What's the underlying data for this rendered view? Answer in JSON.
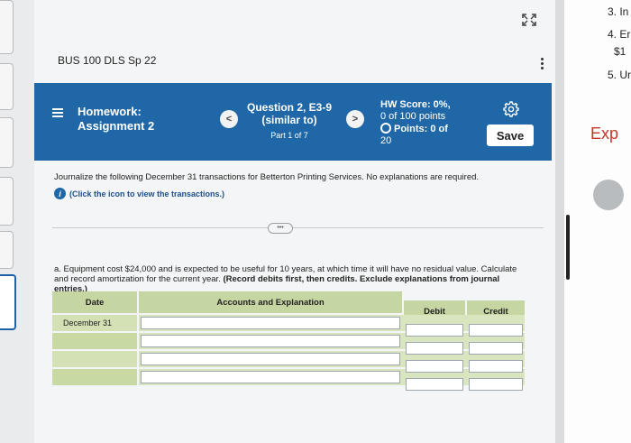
{
  "course": "BUS 100 DLS Sp 22",
  "banner": {
    "homework_line1": "Homework:",
    "homework_line2": "Assignment 2",
    "question_line1": "Question 2, E3-9",
    "question_line2": "(similar to)",
    "part": "Part 1 of 7",
    "score_head": "HW Score: 0%,",
    "score_sub": "0 of 100 points",
    "points_label": "Points: 0 of",
    "points_total": "20",
    "save_label": "Save",
    "prev_symbol": "<",
    "next_symbol": ">"
  },
  "instructions": "Journalize the following December 31 transactions for Betterton Printing Services. No explanations are required.",
  "info_link": "(Click the icon to view the transactions.)",
  "more_pill": "•••",
  "question": {
    "text": "a. Equipment cost $24,000 and is expected to be useful for 10 years, at which time it will have no residual value. Calculate and record amortization for the current year.",
    "emphasis": "(Record debits first, then credits. Exclude explanations from journal entries.)"
  },
  "journal": {
    "headers": {
      "date": "Date",
      "account": "Accounts and Explanation",
      "debit": "Debit",
      "credit": "Credit"
    },
    "rows": [
      {
        "date": "December 31"
      },
      {
        "date": ""
      },
      {
        "date": ""
      },
      {
        "date": ""
      }
    ]
  },
  "side_panel": {
    "items": [
      "3. In",
      "4. Er",
      "$1",
      "5. Ur"
    ],
    "exp": "Exp"
  },
  "colors": {
    "banner": "#1f67a6",
    "table_header": "#c6d6a3",
    "side_accent": "#c0392b"
  }
}
